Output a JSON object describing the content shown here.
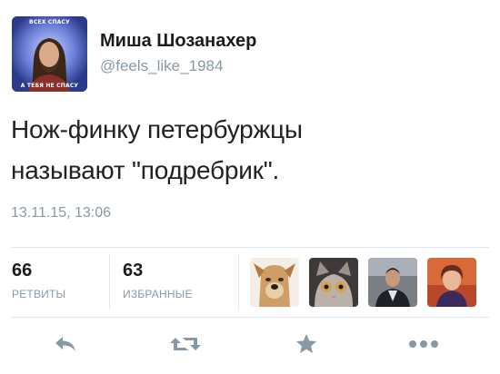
{
  "user": {
    "display_name": "Миша Шозанахер",
    "handle": "@feels_like_1984",
    "avatar": {
      "caption_top": "ВСЕХ СПАСУ",
      "caption_bottom": "А ТЕБЯ НЕ СПАСУ"
    }
  },
  "tweet": {
    "text_lines": [
      "Нож-финку петербуржцы",
      "называют \"подребрик\"."
    ],
    "timestamp": "13.11.15, 13:06"
  },
  "stats": {
    "retweets": {
      "count": "66",
      "label": "РЕТВИТЫ"
    },
    "favorites": {
      "count": "63",
      "label": "ИЗБРАННЫЕ"
    }
  },
  "actions": {
    "reply_icon": "reply-icon",
    "retweet_icon": "retweet-icon",
    "favorite_icon": "star-icon",
    "more_icon": "more-icon"
  },
  "colors": {
    "muted": "#8899a6",
    "icon": "#8899a6",
    "divider": "#e1e8ed"
  }
}
